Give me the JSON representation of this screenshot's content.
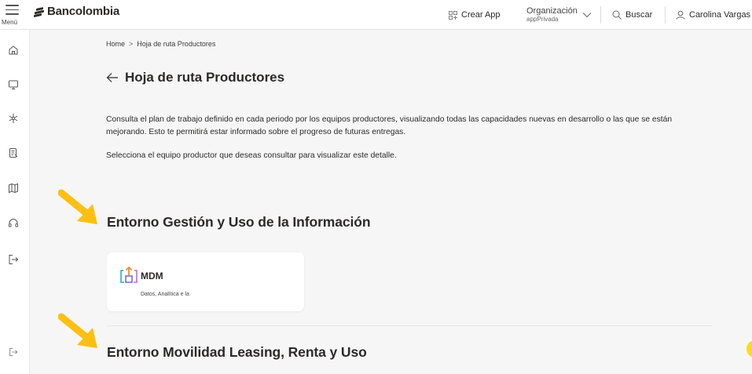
{
  "topbar": {
    "menu_label": "Menú",
    "brand_name": "Bancolombia",
    "crear_app": "Crear App",
    "org_title": "Organización",
    "org_value": "appPrivada",
    "buscar": "Buscar",
    "user_name": "Carolina Vargas"
  },
  "breadcrumb": {
    "home": "Home",
    "separator": ">",
    "current": "Hoja de ruta Productores"
  },
  "page": {
    "title": "Hoja de ruta Productores",
    "description": "Consulta el plan de trabajo definido en cada periodo por los equipos productores, visualizando todas las capacidades nuevas en desarrollo o las que se están mejorando. Esto te permitirá estar informado sobre el progreso de futuras entregas.",
    "instruction": "Selecciona el equipo productor que deseas consultar para visualizar este detalle."
  },
  "sections": [
    {
      "title": "Entorno Gestión y Uso de la Información",
      "cards": [
        {
          "title": "MDM",
          "subtitle": "Datos, Analítica e la"
        }
      ]
    },
    {
      "title": "Entorno Movilidad Leasing, Renta y Uso"
    }
  ],
  "colors": {
    "background": "#f6f6f6",
    "text": "#2c2a29",
    "annotation_arrow": "#fdc012",
    "accent_yellow": "#fdda24"
  },
  "icons": {
    "sidebar": [
      "home-icon",
      "monitor-icon",
      "snowflake-icon",
      "document-icon",
      "map-icon",
      "headset-icon",
      "logout-icon",
      "logout-bottom-icon"
    ],
    "topbar": [
      "menu-icon",
      "grid-icon",
      "chevron-down-icon",
      "search-icon",
      "user-icon"
    ]
  }
}
